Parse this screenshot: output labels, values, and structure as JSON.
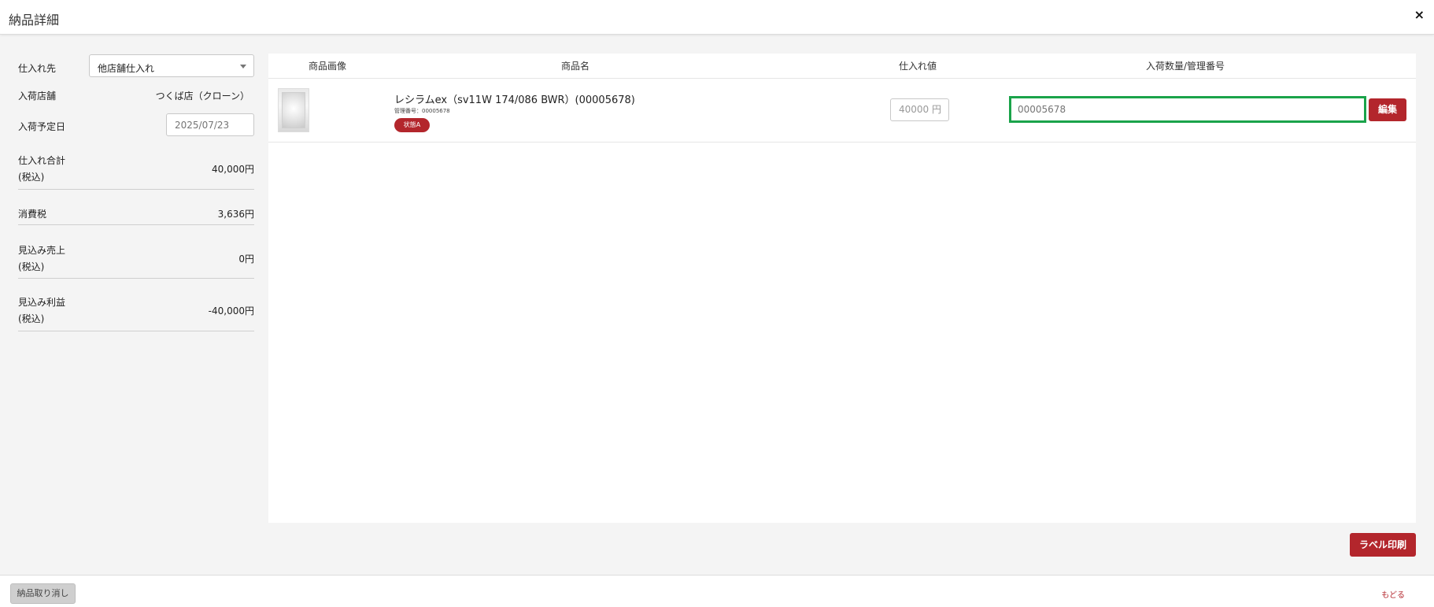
{
  "header": {
    "title": "納品詳細",
    "close_icon": "×"
  },
  "left": {
    "supplier_label": "仕入れ先",
    "supplier_value": "他店舗仕入れ",
    "store_label": "入荷店舗",
    "store_value": "つくば店（クローン）",
    "date_label": "入荷予定日",
    "date_placeholder": "2025/07/23",
    "total_label_1": "仕入れ合計",
    "total_label_2": "(税込)",
    "total_value": "40,000円",
    "tax_label": "消費税",
    "tax_value": "3,636円",
    "sales_label_1": "見込み売上",
    "sales_label_2": "(税込)",
    "sales_value": "0円",
    "profit_label_1": "見込み利益",
    "profit_label_2": "(税込)",
    "profit_value": "-40,000円"
  },
  "table": {
    "headers": [
      "商品画像",
      "商品名",
      "仕入れ値",
      "入荷数量/管理番号"
    ],
    "rows": [
      {
        "name": "レシラムex（sv11W 174/086 BWR）(00005678)",
        "mgmt": "管理番号：00005678",
        "badge": "状態A",
        "price_placeholder": "40000",
        "price_unit": "円",
        "mgmt_placeholder": "00005678",
        "edit_label": "編集"
      }
    ]
  },
  "actions": {
    "print_label": "ラベル印刷"
  },
  "footer": {
    "cancel_label": "納品取り消し",
    "back_label": "もどる"
  },
  "colors": {
    "accent": "#b3262c",
    "focus": "#1aa34a"
  }
}
